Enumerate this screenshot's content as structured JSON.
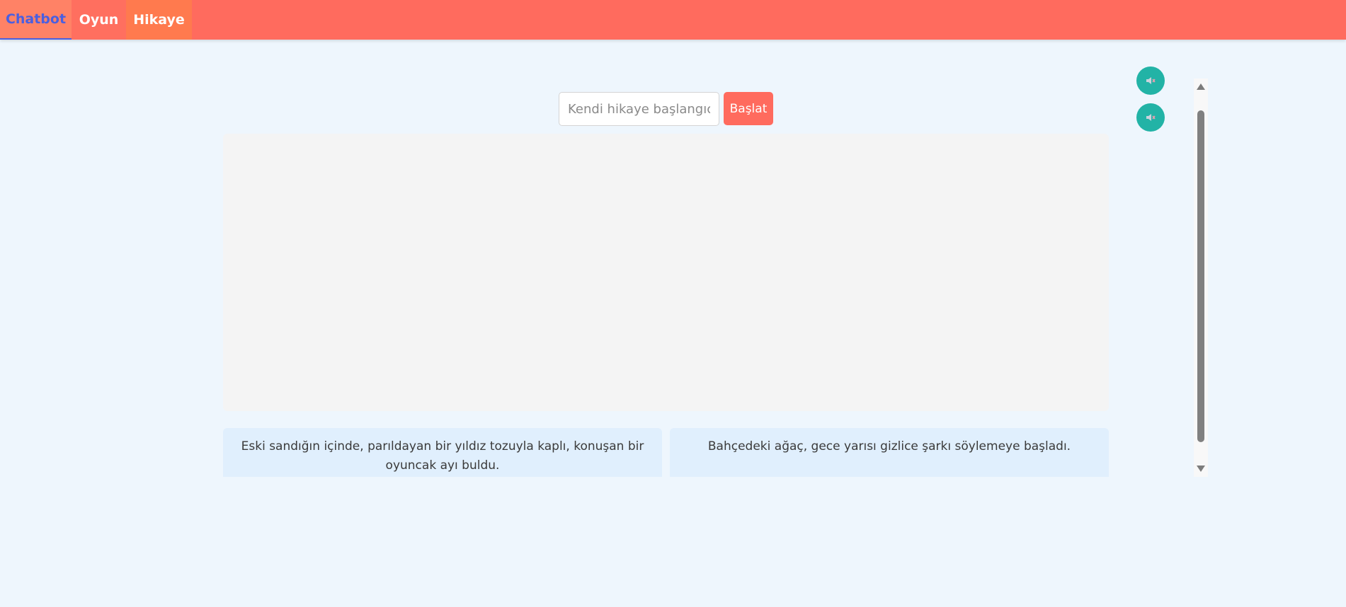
{
  "nav": {
    "tabs": [
      {
        "label": "Chatbot",
        "active": true
      },
      {
        "label": "Oyun",
        "active": false
      },
      {
        "label": "Hikaye",
        "active": false
      }
    ]
  },
  "story": {
    "input_placeholder": "Kendi hikaye başlangıcınızı",
    "input_value": "",
    "start_label": "Başlat"
  },
  "suggestions": [
    "Eski sandığın içinde, parıldayan bir yıldız tozuyla kaplı, konuşan bir oyuncak ayı buldu.",
    "Bahçedeki ağaç, gece yarısı gizlice şarkı söylemeye başladı."
  ],
  "controls": {
    "sound_buttons": [
      {
        "icon": "mute-speaker-icon"
      },
      {
        "icon": "mute-speaker-icon"
      }
    ]
  },
  "colors": {
    "navbar": "#ff6b5e",
    "active_tab_text": "#4a5fe0",
    "start_button": "#ff6b5e",
    "sound_button": "#22b3a6",
    "page_background": "#eef6fd",
    "suggestion_background": "#e0effd"
  }
}
